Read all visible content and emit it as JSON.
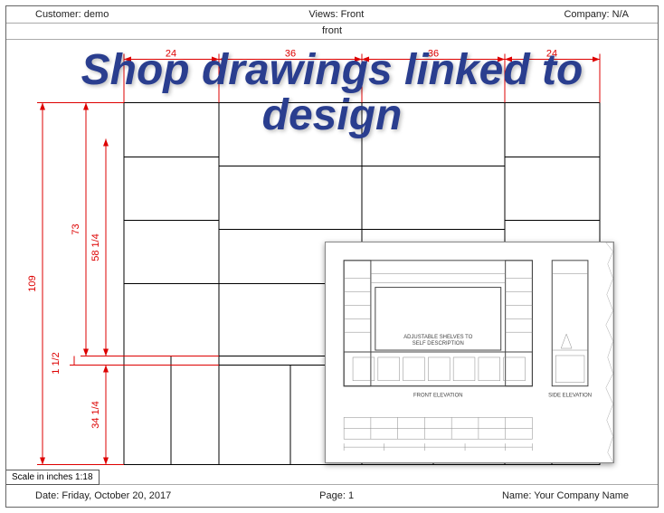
{
  "header": {
    "customer": "Customer: demo",
    "view": "Views: Front",
    "company": "Company: N/A",
    "view_sub": "front"
  },
  "footer": {
    "date": "Date: Friday, October 20, 2017",
    "page": "Page: 1",
    "name": "Name: Your Company Name"
  },
  "scale_label": "Scale in inches 1:18",
  "overlay": "Shop drawings linked to design",
  "dimensions": {
    "top": [
      "24",
      "36",
      "36",
      "24"
    ],
    "left_h": "109",
    "mid_h1": "73",
    "mid_h2": "58 1/4",
    "gap_h": "1 1/2",
    "low_h": "34 1/4"
  },
  "inset": {
    "label_main": "FRONT ELEVATION",
    "label_side": "SIDE ELEVATION",
    "note_upper1": "ADJUSTABLE SHELVES TO",
    "note_upper2": "SELF DESCRIPTION"
  }
}
